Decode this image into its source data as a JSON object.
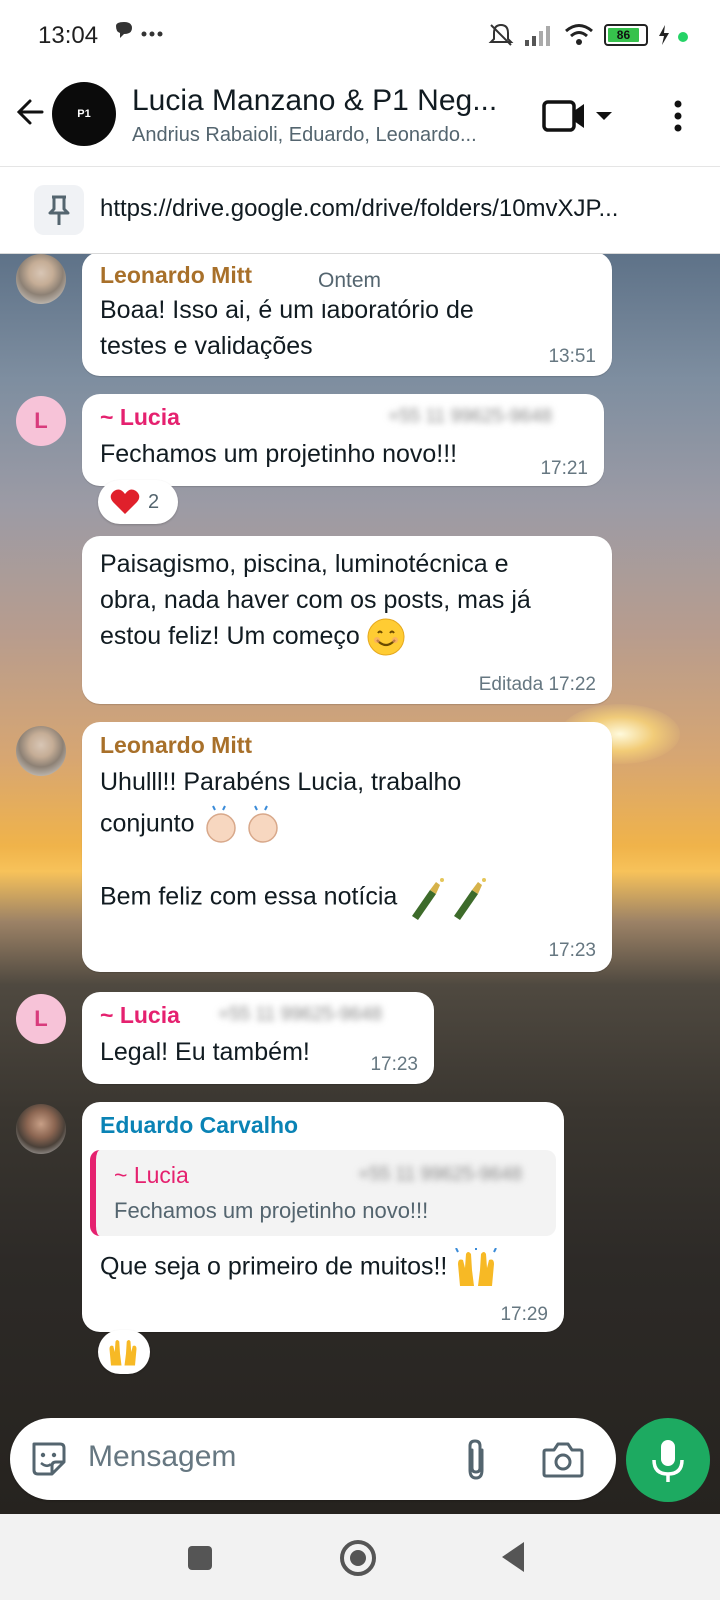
{
  "status_bar": {
    "time": "13:04",
    "left_icons": "● ···",
    "battery_level": "86",
    "battery_color": "#36c24c"
  },
  "header": {
    "title": "Lucia Manzano & P1 Neg...",
    "members": "Andrius Rabaioli, Eduardo, Leonardo...",
    "avatar_text": "P1",
    "icons": [
      "back-arrow-icon",
      "video-call-icon",
      "chevron-down-icon",
      "more-vertical-icon"
    ]
  },
  "pinned": {
    "text": "https://drive.google.com/drive/folders/10mvXJP...",
    "icon": "pin-icon"
  },
  "date_chip": "Ontem",
  "messages": [
    {
      "sender": "Leonardo Mitt",
      "sender_color": "#a8702a",
      "lines": [
        "Boaa! Isso ai, é um laboratório de",
        "testes e validações"
      ],
      "time": "13:51"
    },
    {
      "sender": "~ Lucia",
      "sender_color": "#e5216f",
      "phone": "+55 11 99625-9648",
      "lines": [
        "Fechamos um projetinho novo!!!"
      ],
      "time": "17:21",
      "avatar_letter": "L",
      "reaction": {
        "emoji": "red-heart",
        "count": "2"
      }
    },
    {
      "lines": [
        "Paisagismo, piscina, luminotécnica e",
        "obra, nada haver com os posts, mas já",
        "estou feliz! Um começo"
      ],
      "time": "Editada 17:22",
      "emoji": "smiling-face-icon"
    },
    {
      "sender": "Leonardo Mitt",
      "sender_color": "#a8702a",
      "lines": [
        "Uhulll!! Parabéns Lucia, trabalho",
        "conjunto",
        "Bem feliz com essa notícia"
      ],
      "time": "17:23"
    },
    {
      "sender": "~ Lucia",
      "sender_color": "#e5216f",
      "phone": "+55 11 99625-9648",
      "lines": [
        "Legal! Eu também!"
      ],
      "time": "17:23",
      "avatar_letter": "L"
    },
    {
      "sender": "Eduardo Carvalho",
      "sender_color": "#0a83b5",
      "quote": {
        "sender": "~ Lucia",
        "phone": "+55 11 99625-9648",
        "text": "Fechamos um projetinho novo!!!"
      },
      "lines": [
        "Que seja o primeiro de muitos!!"
      ],
      "time": "17:29",
      "reaction": {
        "emoji": "raising-hands"
      }
    }
  ],
  "input": {
    "placeholder": "Mensagem",
    "icons": [
      "sticker-icon",
      "paperclip-icon",
      "camera-icon",
      "microphone-icon"
    ]
  },
  "nav": {
    "icons": [
      "recents-square-icon",
      "home-circle-icon",
      "back-triangle-icon"
    ]
  },
  "colors": {
    "accent_green": "#1daa61",
    "bubble_white": "#ffffff",
    "lucia_pink": "#e5216f"
  }
}
